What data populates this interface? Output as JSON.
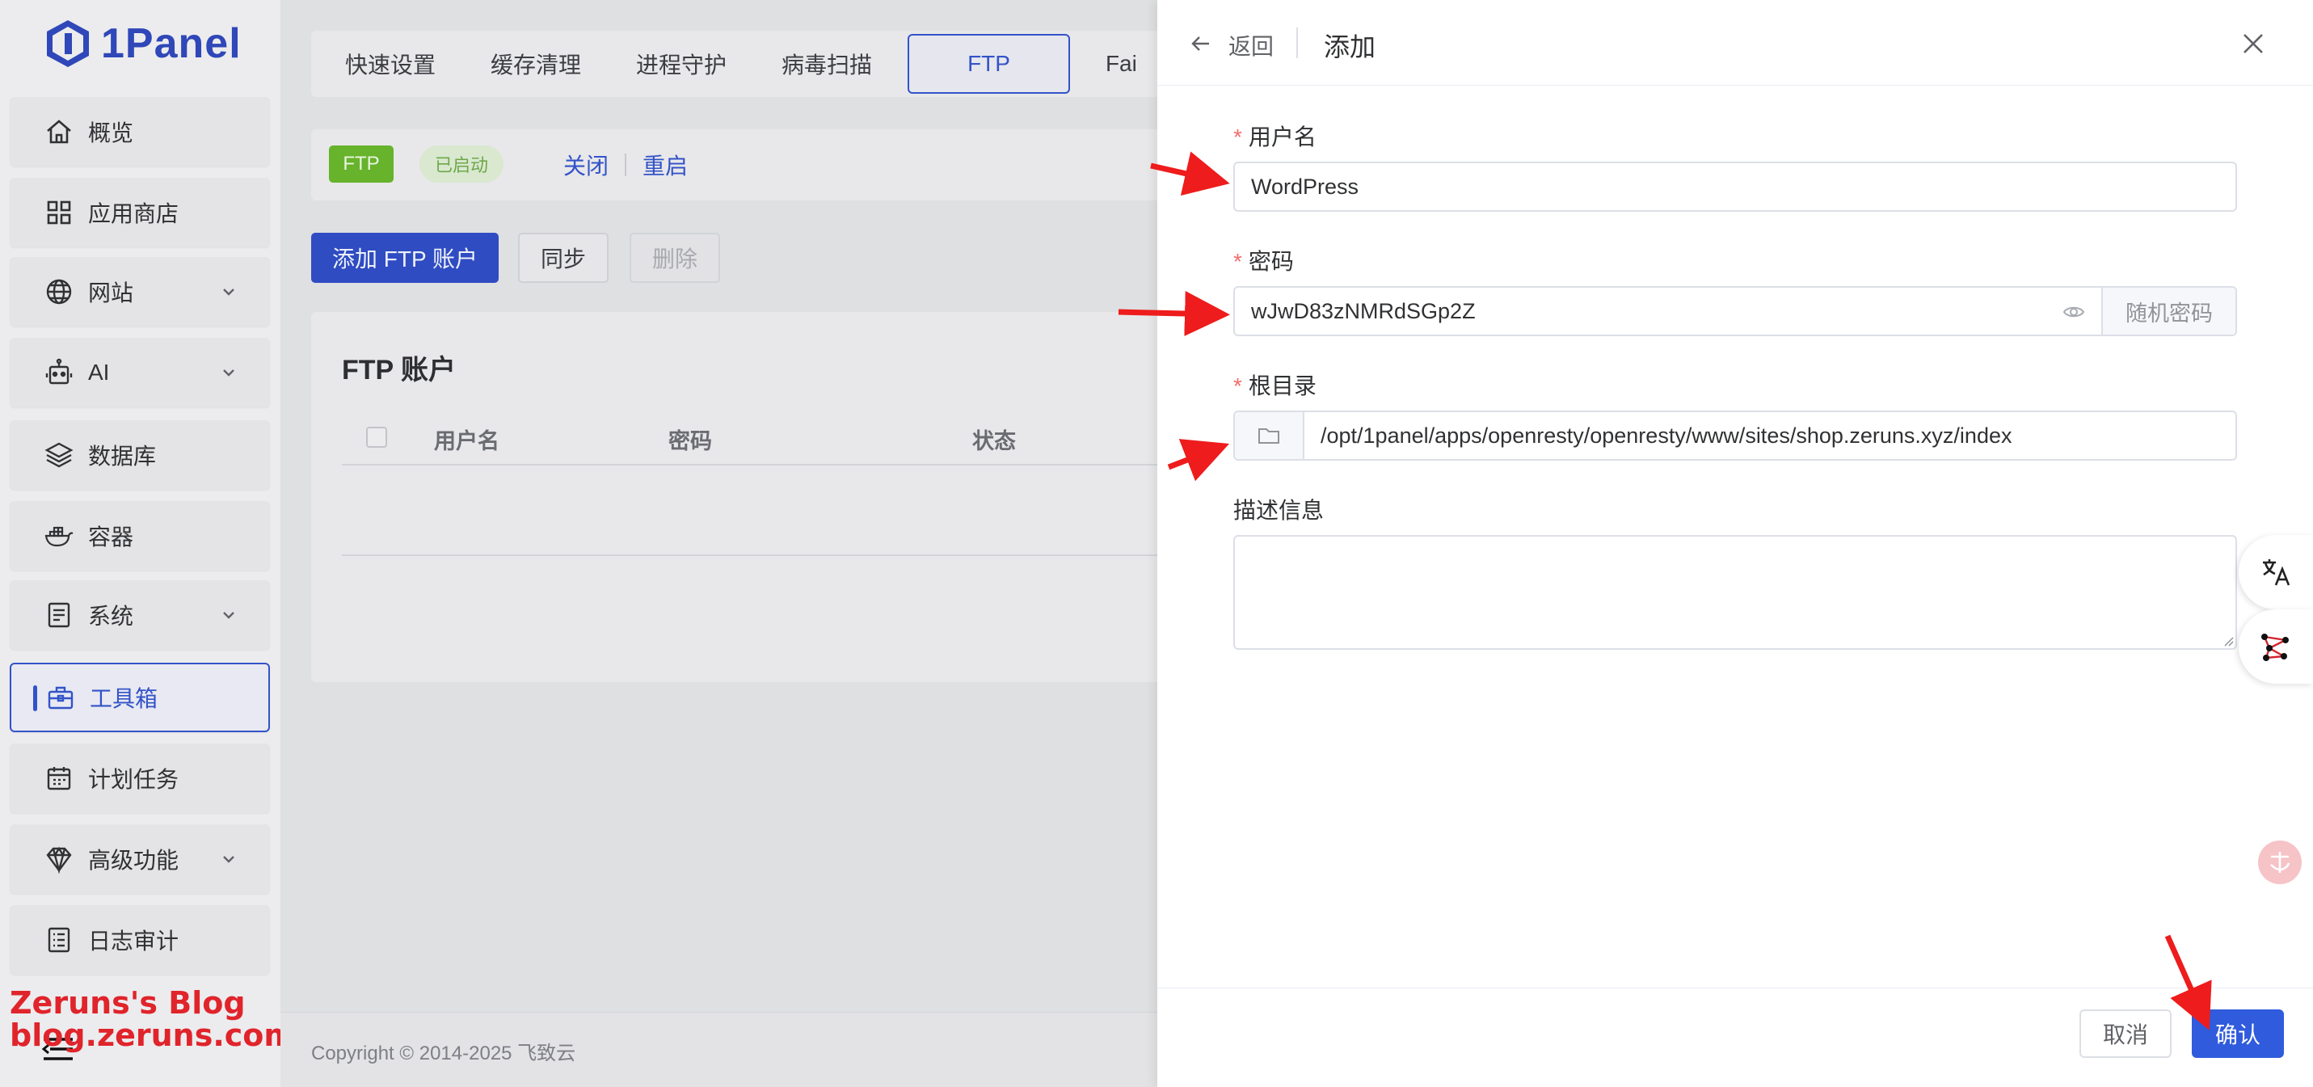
{
  "sidebar": {
    "logo_text": "1Panel",
    "items": [
      {
        "label": "概览",
        "icon": "home-icon",
        "expandable": false
      },
      {
        "label": "应用商店",
        "icon": "grid-icon",
        "expandable": false
      },
      {
        "label": "网站",
        "icon": "globe-icon",
        "expandable": true
      },
      {
        "label": "AI",
        "icon": "robot-icon",
        "expandable": true
      },
      {
        "label": "数据库",
        "icon": "layers-icon",
        "expandable": false
      },
      {
        "label": "容器",
        "icon": "docker-icon",
        "expandable": false
      },
      {
        "label": "系统",
        "icon": "server-icon",
        "expandable": true
      },
      {
        "label": "工具箱",
        "icon": "toolbox-icon",
        "expandable": false,
        "active": true
      },
      {
        "label": "计划任务",
        "icon": "calendar-icon",
        "expandable": false
      },
      {
        "label": "高级功能",
        "icon": "diamond-icon",
        "expandable": true
      },
      {
        "label": "日志审计",
        "icon": "log-icon",
        "expandable": false
      }
    ],
    "watermark_line1": "Zeruns's Blog",
    "watermark_line2": "blog.zeruns.com"
  },
  "main": {
    "tabs": [
      "快速设置",
      "缓存清理",
      "进程守护",
      "病毒扫描",
      "FTP",
      "Fai"
    ],
    "active_tab": "FTP",
    "status": {
      "tag": "FTP",
      "state": "已启动",
      "stop_label": "关闭",
      "restart_label": "重启"
    },
    "actions": {
      "add_label": "添加 FTP 账户",
      "sync_label": "同步",
      "delete_label": "删除"
    },
    "card": {
      "title": "FTP 账户",
      "columns": [
        "用户名",
        "密码",
        "状态"
      ]
    },
    "footer": {
      "copyright": "Copyright © 2014-2025 飞致云"
    }
  },
  "drawer": {
    "back_label": "返回",
    "title": "添加",
    "form": {
      "username_label": "用户名",
      "username_value": "WordPress",
      "password_label": "密码",
      "password_value": "wJwD83zNMRdSGp2Z",
      "random_password_label": "随机密码",
      "rootdir_label": "根目录",
      "rootdir_value": "/opt/1panel/apps/openresty/openresty/www/sites/shop.zeruns.xyz/index",
      "description_label": "描述信息",
      "description_value": ""
    },
    "cancel_label": "取消",
    "confirm_label": "确认"
  },
  "colors": {
    "primary": "#3353c8",
    "confirm": "#2f5bdc",
    "success": "#67b32c",
    "required": "#f56c6c",
    "annotation_arrow": "#ee1c1c",
    "watermark": "#e0242b"
  }
}
